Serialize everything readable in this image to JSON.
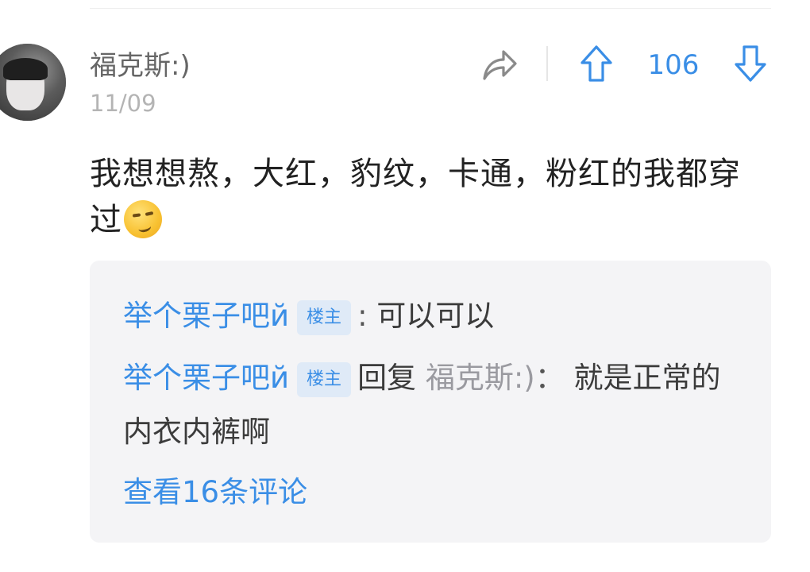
{
  "comment": {
    "username": "福克斯:)",
    "date": "11/09",
    "text": "我想想熬，大红，豹纹，卡通，粉红的我都穿过",
    "emoji": "smirk-emoji",
    "vote_count": "106"
  },
  "replies": [
    {
      "user": "举个栗子吧й",
      "badge": "楼主",
      "separator": ":",
      "text": "可以可以"
    },
    {
      "user": "举个栗子吧й",
      "badge": "楼主",
      "reply_word": "回复",
      "reply_to": "福克斯:)",
      "separator": "：",
      "text": "就是正常的内衣内裤啊"
    }
  ],
  "view_more": "查看16条评论",
  "colors": {
    "accent": "#3a8ee6",
    "badge_bg": "#dfeaf7",
    "reply_box_bg": "#f4f4f6"
  },
  "icons": [
    "share-icon",
    "upvote-icon",
    "downvote-icon"
  ]
}
